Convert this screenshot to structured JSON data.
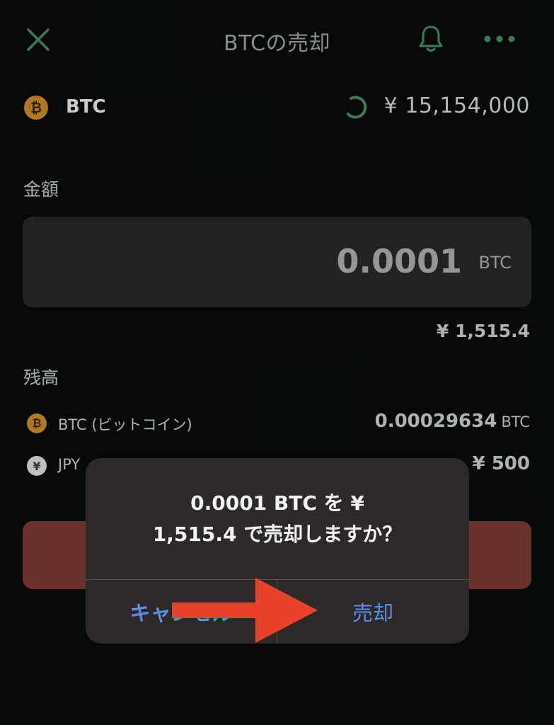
{
  "header": {
    "title": "BTCの売却"
  },
  "asset": {
    "coin_glyph": "₿",
    "name": "BTC",
    "price": "¥ 15,154,000"
  },
  "amount": {
    "label": "金額",
    "value": "0.0001",
    "unit": "BTC",
    "jpy_equivalent": "¥ 1,515.4"
  },
  "balance": {
    "label": "残高",
    "items": [
      {
        "glyph": "₿",
        "name": "BTC (ビットコイン)",
        "value": "0.00029634",
        "unit": "BTC"
      },
      {
        "glyph": "¥",
        "name": "JPY",
        "value": "¥ 500",
        "unit": ""
      }
    ]
  },
  "dialog": {
    "message_line1": "0.0001 BTC を ¥",
    "message_line2": "1,515.4 で売却しますか？",
    "cancel_label": "キャンセル",
    "confirm_label": "売却"
  },
  "colors": {
    "accent_green": "#3f8f62",
    "btc_orange": "#c98a24",
    "sell_button": "#7a3a33",
    "dialog_link": "#5b8ee6",
    "annotation_arrow": "#e8432a"
  },
  "icons": {
    "close": "close-icon",
    "bell": "bell-icon",
    "more": "more-icon",
    "loading": "loading-spinner-icon",
    "arrow": "arrow-right-icon"
  }
}
